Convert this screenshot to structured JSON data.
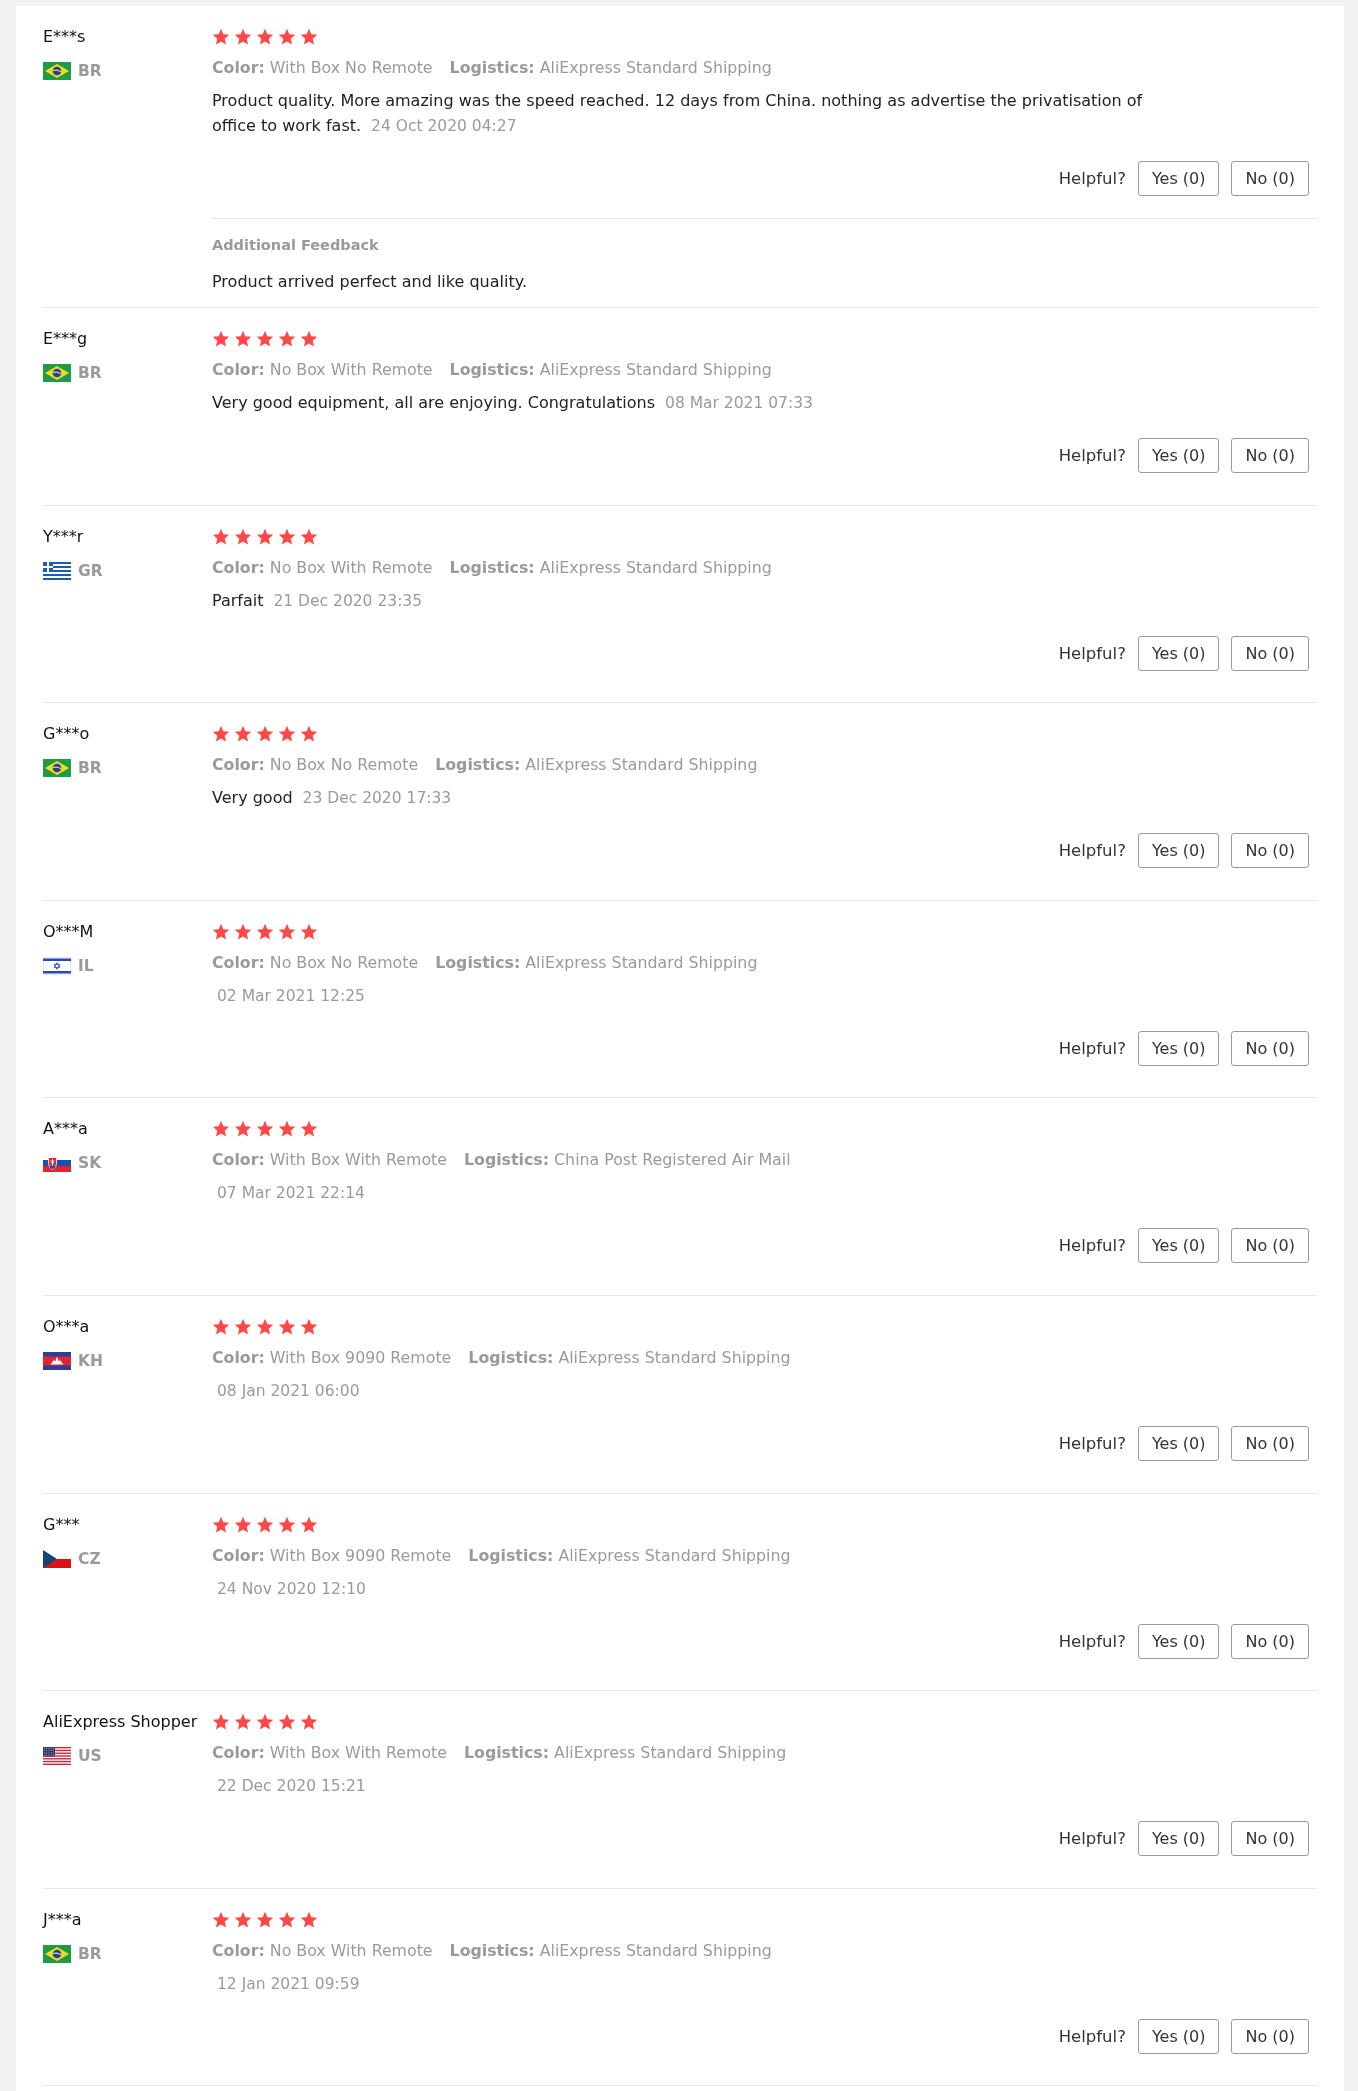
{
  "reviews": [
    {
      "kind": "brazil",
      "reviewer": "E***s",
      "country_code": "BR",
      "stars": 5,
      "attributes": [
        "**Color:** With Box No Remote",
        "**Logistics:** AliExpress Standard Shipping"
      ],
      "text": "Product quality. More amazing was the speed reached. 12 days from China. nothing as advertise the privatisation of office to work fast.",
      "date": "24 Oct 2020 04:27",
      "helpful": {
        "label": "Helpful?",
        "buttons": [
          "Yes (0)",
          "No (0)"
        ]
      },
      "additional_feedback": {
        "title": "Additional Feedback",
        "text": "Product arrived perfect and like quality."
      }
    },
    {
      "kind": "brazil",
      "reviewer": "E***g",
      "country_code": "BR",
      "stars": 5,
      "attributes": [
        "**Color:** No Box With Remote",
        "**Logistics:** AliExpress Standard Shipping"
      ],
      "text": "Very good equipment, all are enjoying. Congratulations",
      "date": "08 Mar 2021 07:33",
      "helpful": {
        "label": "Helpful?",
        "buttons": [
          "Yes (0)",
          "No (0)"
        ]
      }
    },
    {
      "kind": "greece",
      "reviewer": "Y***r",
      "country_code": "GR",
      "stars": 5,
      "attributes": [
        "**Color:** No Box With Remote",
        "**Logistics:** AliExpress Standard Shipping"
      ],
      "text": "Parfait",
      "date": "21 Dec 2020 23:35",
      "helpful": {
        "label": "Helpful?",
        "buttons": [
          "Yes (0)",
          "No (0)"
        ]
      }
    },
    {
      "kind": "brazil",
      "reviewer": "G***o",
      "country_code": "BR",
      "stars": 5,
      "attributes": [
        "**Color:** No Box No Remote",
        "**Logistics:** AliExpress Standard Shipping"
      ],
      "text": "Very good",
      "date": "23 Dec 2020 17:33",
      "helpful": {
        "label": "Helpful?",
        "buttons": [
          "Yes (0)",
          "No (0)"
        ]
      }
    },
    {
      "kind": "israel",
      "reviewer": "O***M",
      "country_code": "IL",
      "stars": 5,
      "attributes": [
        "**Color:** No Box No Remote",
        "**Logistics:** AliExpress Standard Shipping"
      ],
      "date": "02 Mar 2021 12:25",
      "helpful": {
        "label": "Helpful?",
        "buttons": [
          "Yes (0)",
          "No (0)"
        ]
      }
    },
    {
      "kind": "slovakia",
      "reviewer": "A***a",
      "country_code": "SK",
      "stars": 5,
      "attributes": [
        "**Color:** With Box With Remote",
        "**Logistics:** China Post Registered Air Mail"
      ],
      "date": "07 Mar 2021 22:14",
      "helpful": {
        "label": "Helpful?",
        "buttons": [
          "Yes (0)",
          "No (0)"
        ]
      }
    },
    {
      "kind": "cambodia",
      "reviewer": "O***a",
      "country_code": "KH",
      "stars": 5,
      "attributes": [
        "**Color:** With Box 9090 Remote",
        "**Logistics:** AliExpress Standard Shipping"
      ],
      "date": "08 Jan 2021 06:00",
      "helpful": {
        "label": "Helpful?",
        "buttons": [
          "Yes (0)",
          "No (0)"
        ]
      }
    },
    {
      "kind": "czech",
      "reviewer": "G***",
      "country_code": "CZ",
      "stars": 5,
      "attributes": [
        "**Color:** With Box 9090 Remote",
        "**Logistics:** AliExpress Standard Shipping"
      ],
      "date": "24 Nov 2020 12:10",
      "helpful": {
        "label": "Helpful?",
        "buttons": [
          "Yes (0)",
          "No (0)"
        ]
      }
    },
    {
      "kind": "usa",
      "reviewer": "AliExpress Shopper",
      "country_code": "US",
      "stars": 5,
      "attributes": [
        "**Color:** With Box With Remote",
        "**Logistics:** AliExpress Standard Shipping"
      ],
      "date": "22 Dec 2020 15:21",
      "helpful": {
        "label": "Helpful?",
        "buttons": [
          "Yes (0)",
          "No (0)"
        ]
      }
    },
    {
      "kind": "brazil",
      "reviewer": "J***a",
      "country_code": "BR",
      "stars": 5,
      "attributes": [
        "**Color:** No Box With Remote",
        "**Logistics:** AliExpress Standard Shipping"
      ],
      "date": "12 Jan 2021 09:59",
      "helpful": {
        "label": "Helpful?",
        "buttons": [
          "Yes (0)",
          "No (0)"
        ]
      }
    }
  ]
}
